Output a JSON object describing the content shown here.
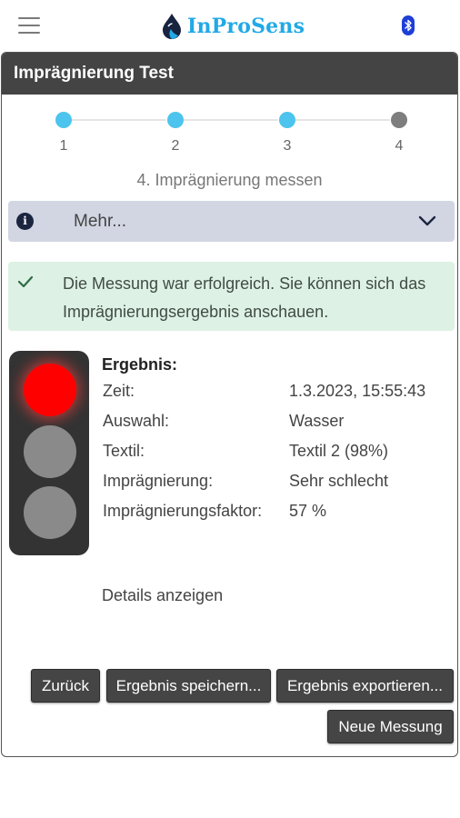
{
  "app": {
    "brand_name": "InProSens",
    "brand_color": "#22a9e6"
  },
  "icons": {
    "menu": "hamburger-icon",
    "logo": "water-drop-logo",
    "bluetooth": "bluetooth-icon",
    "info": "info-icon",
    "chevron": "chevron-down-icon",
    "check": "check-icon"
  },
  "card": {
    "title": "Imprägnierung Test"
  },
  "stepper": {
    "steps": [
      {
        "label": "1",
        "state": "done"
      },
      {
        "label": "2",
        "state": "done"
      },
      {
        "label": "3",
        "state": "done"
      },
      {
        "label": "4",
        "state": "current"
      }
    ],
    "current_title": "4. Imprägnierung messen"
  },
  "accordion": {
    "label": "Mehr..."
  },
  "alert": {
    "text": "Die Messung war erfolgreich. Sie können sich das Imprägnierungsergebnis anschauen."
  },
  "traffic_light": {
    "active": "red",
    "colors": {
      "red": "#ff0000",
      "off": "#8a8a8a",
      "body": "#333333"
    }
  },
  "result": {
    "heading": "Ergebnis:",
    "rows": [
      {
        "key": "Zeit:",
        "value": "1.3.2023, 15:55:43"
      },
      {
        "key": "Auswahl:",
        "value": "Wasser"
      },
      {
        "key": "Textil:",
        "value": "Textil 2 (98%)"
      },
      {
        "key": "Imprägnierung:",
        "value": "Sehr schlecht"
      },
      {
        "key": "Imprägnierungsfaktor:",
        "value": "57 %"
      }
    ],
    "details_link": "Details anzeigen"
  },
  "buttons": {
    "back": "Zurück",
    "save": "Ergebnis speichern...",
    "export": "Ergebnis exportieren...",
    "new": "Neue Messung"
  }
}
